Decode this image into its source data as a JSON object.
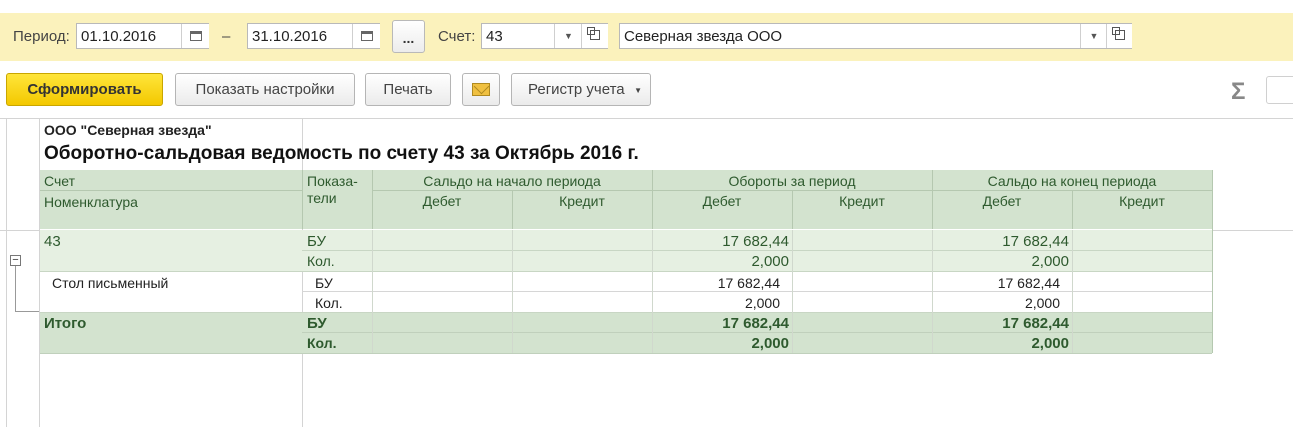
{
  "filter": {
    "period_label": "Период:",
    "date_from": "01.10.2016",
    "dash": "–",
    "date_to": "31.10.2016",
    "more_button": "...",
    "account_label": "Счет:",
    "account_value": "43",
    "organization_value": "Северная звезда ООО"
  },
  "toolbar": {
    "generate": "Сформировать",
    "show_settings": "Показать настройки",
    "print": "Печать",
    "register": "Регистр учета",
    "sigma": "Σ"
  },
  "report": {
    "org": "ООО \"Северная звезда\"",
    "title": "Оборотно-сальдовая ведомость по счету 43 за Октябрь 2016 г.",
    "headers": {
      "account": "Счет",
      "nomenclature": "Номенклатура",
      "indicators_1": "Показа-",
      "indicators_2": "тели",
      "balance_start": "Сальдо на начало периода",
      "turnover": "Обороты за период",
      "balance_end": "Сальдо на конец периода",
      "debit": "Дебет",
      "credit": "Кредит"
    },
    "rows": {
      "account": "43",
      "acc_bu": "БУ",
      "acc_bu_turn_debit": "17 682,44",
      "acc_bu_end_debit": "17 682,44",
      "acc_qty": "Кол.",
      "acc_qty_turn_debit": "2,000",
      "acc_qty_end_debit": "2,000",
      "item": "Стол письменный",
      "item_bu": "БУ",
      "item_bu_turn_debit": "17 682,44",
      "item_bu_end_debit": "17 682,44",
      "item_qty": "Кол.",
      "item_qty_turn_debit": "2,000",
      "item_qty_end_debit": "2,000",
      "total": "Итого",
      "total_bu": "БУ",
      "total_bu_turn_debit": "17 682,44",
      "total_bu_end_debit": "17 682,44",
      "total_qty": "Кол.",
      "total_qty_turn_debit": "2,000",
      "total_qty_end_debit": "2,000"
    }
  },
  "colors": {
    "filter_bg": "#fbf2bc",
    "primary_button": "#f3c800",
    "header_green": "#d3e3cf",
    "row_green": "#e6f0e2",
    "text_green": "#2e5a2e"
  }
}
